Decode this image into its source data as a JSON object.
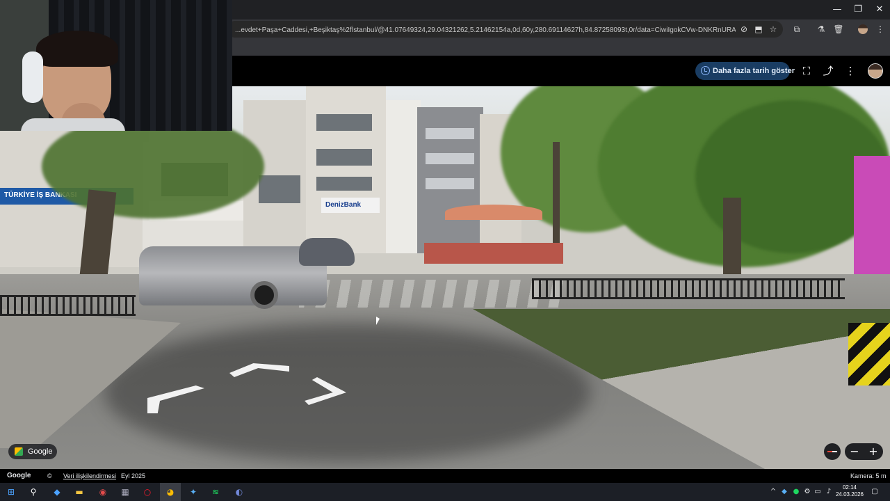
{
  "browser": {
    "url": "...evdet+Paşa+Caddesi,+Beşiktaş%2fİstanbul/@41.07649324,29.04321262,5.21462154a,0d,60y,280.69114627h,84.87258093t,0r/data=CiwiIgokCVw-DNKRnURAEXUa-vUPeURAG...",
    "window_controls": {
      "minimize": "—",
      "restore": "❐",
      "close": "✕"
    },
    "toolbar_icons": [
      "eye-off-icon",
      "install-icon",
      "star-icon",
      "extensions-icon",
      "lab-icon",
      "delete-icon",
      "profile-icon",
      "more-icon"
    ]
  },
  "maps": {
    "history_button": "Daha fazla tarih göster",
    "header_icons": {
      "screenshot": "⛶",
      "share": "⤴",
      "more": "⋮"
    },
    "google_chip": "Google",
    "zoom": {
      "minus": "−",
      "plus": "+"
    }
  },
  "street_signs": {
    "bank1": "TÜRKİYE İŞ BANKASI",
    "bank2": "DenizBank"
  },
  "footer": {
    "logo": "Google",
    "copyright": "©",
    "link_report": "Veri ilişkilendirmesi",
    "date": "Eyl 2025",
    "camera": "Kamera: 5 m"
  },
  "taskbar": {
    "time": "02:14",
    "date": "24.03.2026"
  },
  "colors": {
    "accent": "#1a3d63",
    "accent_text": "#e3eefc",
    "taskbar": "#1c1f26"
  }
}
